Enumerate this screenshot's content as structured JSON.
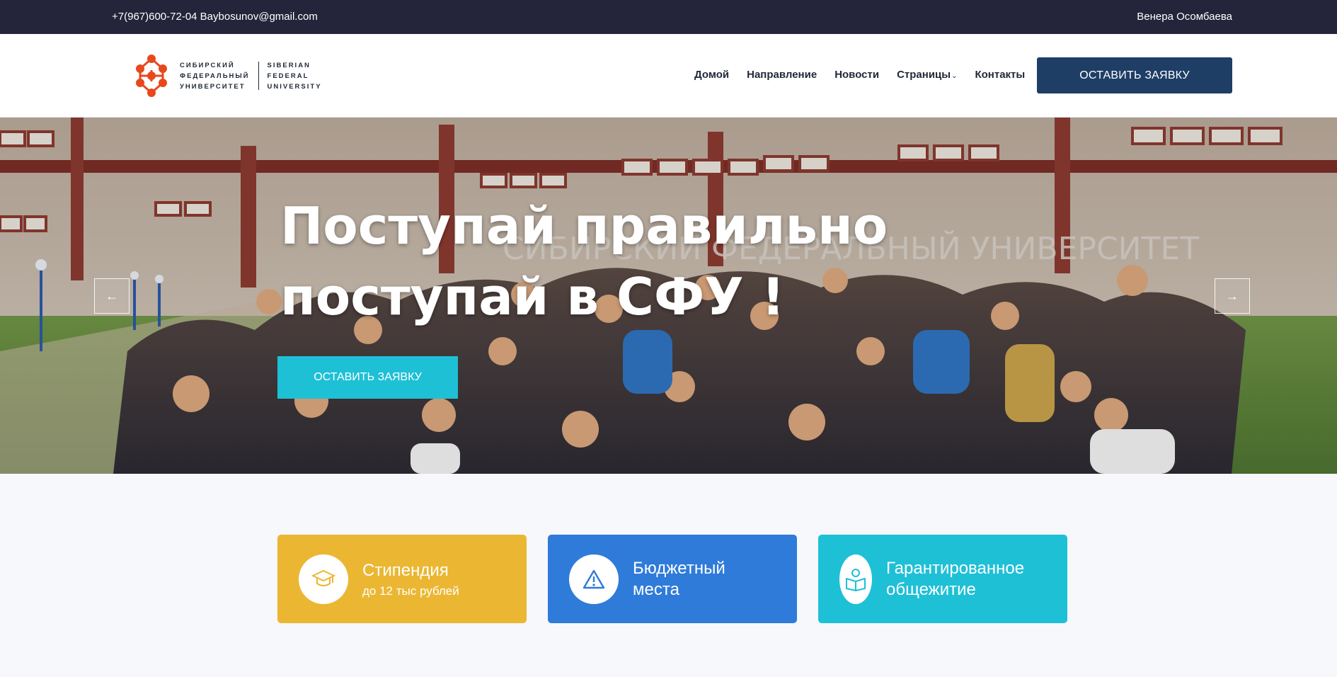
{
  "topbar": {
    "contacts": "+7(967)600-72-04 Baybosunov@gmail.com",
    "user": "Венера Осомбаева"
  },
  "logo": {
    "ru_lines": [
      "СИБИРСКИЙ",
      "ФЕДЕРАЛЬНЫЙ",
      "УНИВЕРСИТЕТ"
    ],
    "en_lines": [
      "SIBERIAN",
      "FEDERAL",
      "UNIVERSITY"
    ],
    "color": "#e8481d"
  },
  "nav": {
    "items": [
      {
        "label": "Домой"
      },
      {
        "label": "Направление"
      },
      {
        "label": "Новости"
      },
      {
        "label": "Страницы"
      },
      {
        "label": "Контакты"
      }
    ],
    "cta_label": "ОСТАВИТЬ ЗАЯВКУ"
  },
  "hero": {
    "title_line1": "Поступай правильно",
    "title_line2": "поступай в СФУ !",
    "building_sign": "СИБИРСКИЙ ФЕДЕРАЛЬНЫЙ УНИВЕРСИТЕТ",
    "cta_label": "ОСТАВИТЬ ЗАЯВКУ",
    "prev_icon": "arrow-left-icon",
    "next_icon": "arrow-right-icon"
  },
  "features": [
    {
      "title": "Стипендия",
      "subtitle": "до 12 тыс рублей",
      "icon": "graduation-cap-icon",
      "color": "#ebb733"
    },
    {
      "title": "Бюджетный\nместа",
      "subtitle": "",
      "icon": "warning-icon",
      "color": "#2f7bd9"
    },
    {
      "title": "Гарантированное\nобщежитие",
      "subtitle": "",
      "icon": "book-reader-icon",
      "color": "#1ec0d6"
    }
  ],
  "colors": {
    "topbar_bg": "#24253a",
    "header_cta_bg": "#1e3e66",
    "hero_cta_bg": "#1ec0d6"
  }
}
